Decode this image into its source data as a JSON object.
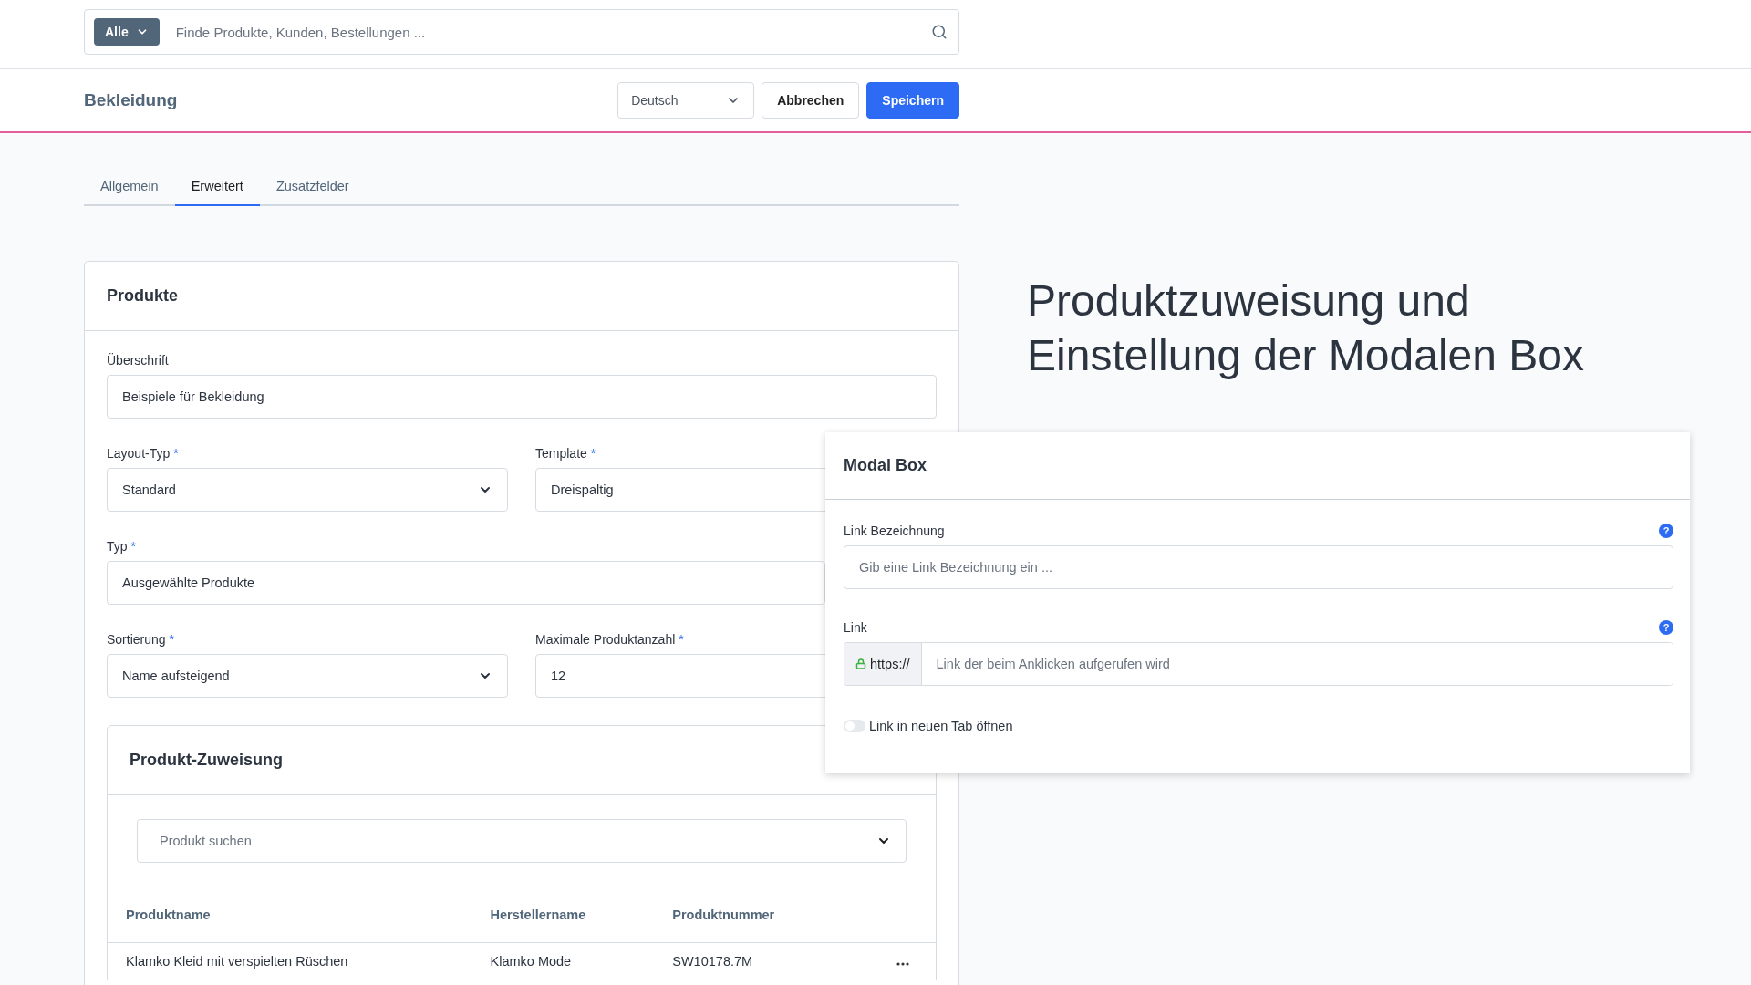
{
  "search": {
    "scope": "Alle",
    "placeholder": "Finde Produkte, Kunden, Bestellungen ..."
  },
  "header": {
    "title": "Bekleidung",
    "language": "Deutsch",
    "buttons": [
      {
        "label": "Abbrechen",
        "kind": "secondary"
      },
      {
        "label": "Speichern",
        "kind": "primary"
      }
    ]
  },
  "tabs": [
    {
      "label": "Allgemein",
      "selected": false
    },
    {
      "label": "Erweitert",
      "selected": true
    },
    {
      "label": "Zusatzfelder",
      "selected": false
    }
  ],
  "card": {
    "title": "Produkte",
    "rows": [
      [
        {
          "label": "Überschrift",
          "kind": "input",
          "value": "Beispiele für Bekleidung"
        }
      ],
      [
        {
          "label": "Layout-Typ",
          "required_mark": "*",
          "kind": "select",
          "value": "Standard"
        },
        {
          "label": "Template",
          "required_mark": "*",
          "kind": "input",
          "value": "Dreispaltig"
        }
      ],
      [
        {
          "label": "Typ",
          "required_mark": "*",
          "kind": "input",
          "value": "Ausgewählte Produkte"
        }
      ],
      [
        {
          "label": "Sortierung",
          "required_mark": "*",
          "kind": "select",
          "value": "Name aufsteigend"
        },
        {
          "label": "Maximale Produktanzahl",
          "required_mark": "*",
          "kind": "input",
          "value": "12"
        }
      ]
    ]
  },
  "assignment": {
    "title": "Produkt-Zuweisung",
    "search": {
      "placeholder": "Produkt suchen"
    },
    "columns": [
      "Produktname",
      "Herstellername",
      "Produktnummer"
    ],
    "rows": [
      {
        "cells": [
          "Klamko Kleid mit verspielten Rüschen",
          "Klamko Mode",
          "SW10178.7M"
        ]
      }
    ]
  },
  "headline": "Produktzuweisung und Einstellung der Modalen Box",
  "modal": {
    "title": "Modal Box",
    "fields": [
      {
        "label": "Link Bezeichnung",
        "help": "?",
        "placeholder": "Gib eine Link Bezeichnung ein ..."
      },
      {
        "label": "Link",
        "help": "?",
        "prefix": "https://",
        "placeholder": "Link der beim Anklicken aufgerufen wird"
      }
    ],
    "toggle": {
      "label": "Link in neuen Tab öffnen",
      "on": false
    }
  }
}
